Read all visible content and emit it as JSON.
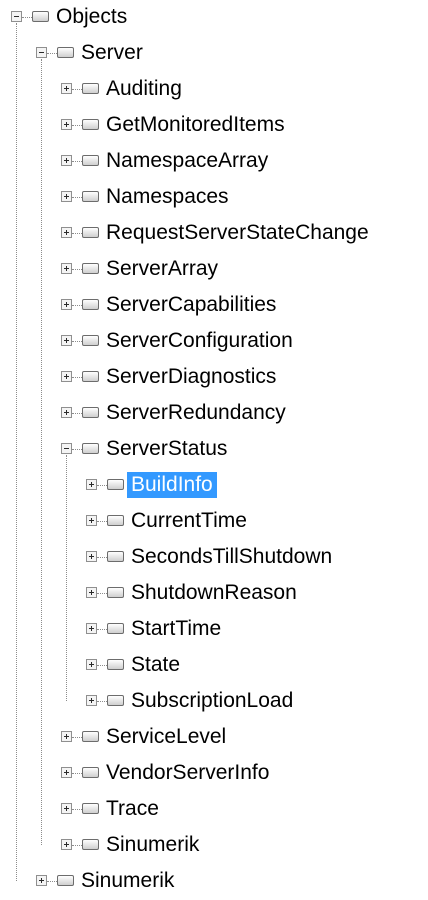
{
  "tree": {
    "nodes": [
      {
        "label": "Objects",
        "level": 0,
        "expanded": true,
        "selected": false
      },
      {
        "label": "Server",
        "level": 1,
        "expanded": true,
        "selected": false
      },
      {
        "label": "Auditing",
        "level": 2,
        "expanded": false,
        "selected": false
      },
      {
        "label": "GetMonitoredItems",
        "level": 2,
        "expanded": false,
        "selected": false
      },
      {
        "label": "NamespaceArray",
        "level": 2,
        "expanded": false,
        "selected": false
      },
      {
        "label": "Namespaces",
        "level": 2,
        "expanded": false,
        "selected": false
      },
      {
        "label": "RequestServerStateChange",
        "level": 2,
        "expanded": false,
        "selected": false
      },
      {
        "label": "ServerArray",
        "level": 2,
        "expanded": false,
        "selected": false
      },
      {
        "label": "ServerCapabilities",
        "level": 2,
        "expanded": false,
        "selected": false
      },
      {
        "label": "ServerConfiguration",
        "level": 2,
        "expanded": false,
        "selected": false
      },
      {
        "label": "ServerDiagnostics",
        "level": 2,
        "expanded": false,
        "selected": false
      },
      {
        "label": "ServerRedundancy",
        "level": 2,
        "expanded": false,
        "selected": false
      },
      {
        "label": "ServerStatus",
        "level": 2,
        "expanded": true,
        "selected": false
      },
      {
        "label": "BuildInfo",
        "level": 3,
        "expanded": false,
        "selected": true
      },
      {
        "label": "CurrentTime",
        "level": 3,
        "expanded": false,
        "selected": false
      },
      {
        "label": "SecondsTillShutdown",
        "level": 3,
        "expanded": false,
        "selected": false
      },
      {
        "label": "ShutdownReason",
        "level": 3,
        "expanded": false,
        "selected": false
      },
      {
        "label": "StartTime",
        "level": 3,
        "expanded": false,
        "selected": false
      },
      {
        "label": "State",
        "level": 3,
        "expanded": false,
        "selected": false
      },
      {
        "label": "SubscriptionLoad",
        "level": 3,
        "expanded": false,
        "selected": false
      },
      {
        "label": "ServiceLevel",
        "level": 2,
        "expanded": false,
        "selected": false
      },
      {
        "label": "VendorServerInfo",
        "level": 2,
        "expanded": false,
        "selected": false
      },
      {
        "label": "Trace",
        "level": 2,
        "expanded": false,
        "selected": false
      },
      {
        "label": "Sinumerik",
        "level": 2,
        "expanded": false,
        "selected": false
      },
      {
        "label": "Sinumerik",
        "level": 1,
        "expanded": false,
        "selected": false
      }
    ]
  },
  "colors": {
    "selection": "#3399ff",
    "selection_text": "#ffffff",
    "lines": "#8c8c8c"
  },
  "icons": {
    "expanded": "minus-box-icon",
    "collapsed": "plus-box-icon",
    "node": "node-icon"
  }
}
